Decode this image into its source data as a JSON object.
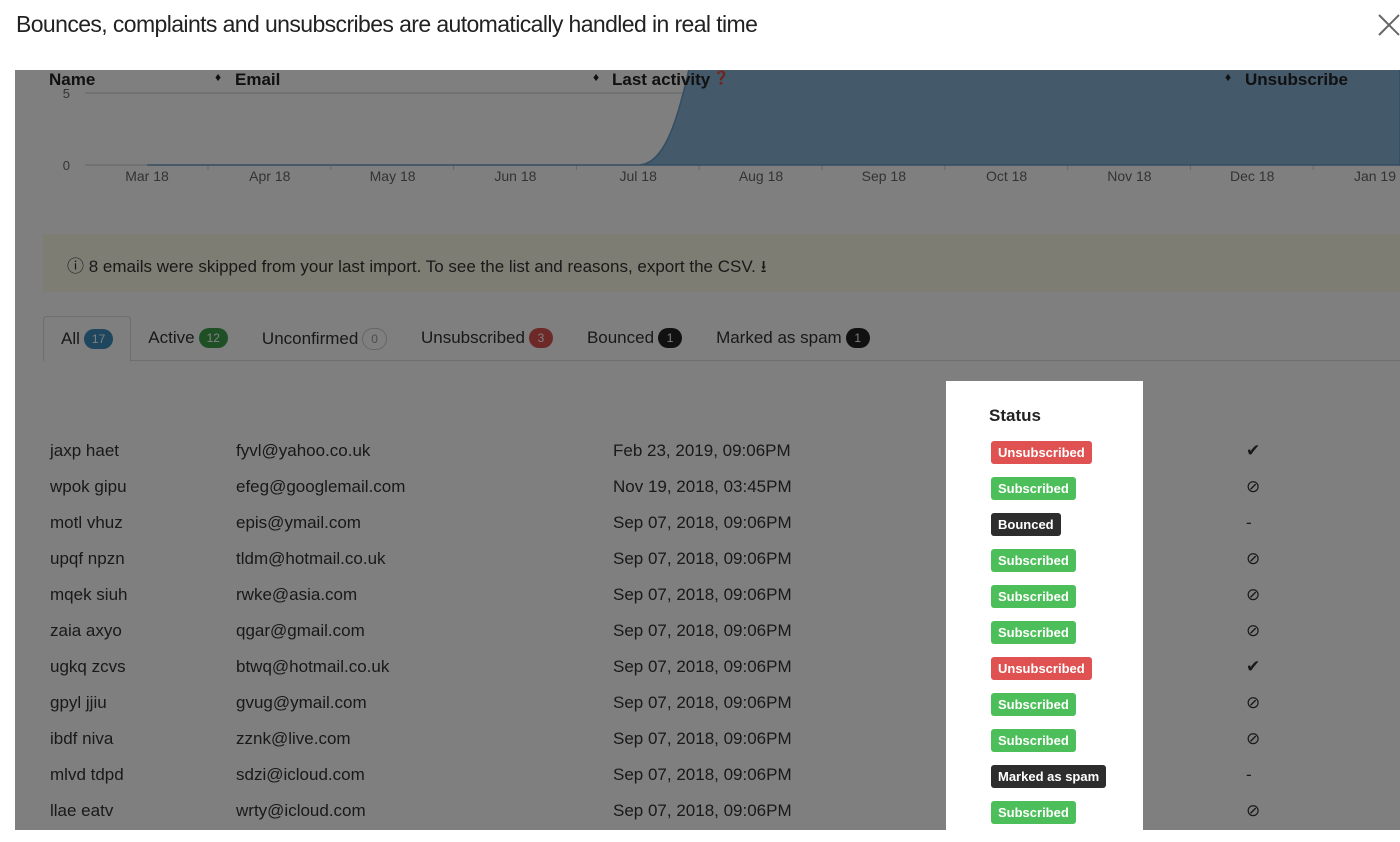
{
  "dialog": {
    "title": "Bounces, complaints and unsubscribes are automatically handled in real time",
    "close_icon": "close-icon"
  },
  "chart_data": {
    "type": "area",
    "x_ticks": [
      "Mar 18",
      "Apr 18",
      "May 18",
      "Jun 18",
      "Jul 18",
      "Aug 18",
      "Sep 18",
      "Oct 18",
      "Nov 18",
      "Dec 18",
      "Jan 19"
    ],
    "y_ticks": [
      "0",
      "5"
    ],
    "x": [
      "2018-03",
      "2018-04",
      "2018-05",
      "2018-06",
      "2018-07",
      "2018-08",
      "2018-09",
      "2018-10",
      "2018-11",
      "2018-12",
      "2019-01"
    ],
    "values": [
      0,
      0,
      0,
      0,
      0,
      17,
      17,
      17,
      17,
      17,
      17
    ],
    "color": "#88b2d4",
    "grid": true
  },
  "alert": {
    "text": "8 emails were skipped from your last import. To see the list and reasons, export the CSV.",
    "icon": "info-circle-icon",
    "download_icon": "download-icon"
  },
  "tabs": [
    {
      "label": "All",
      "count": "17",
      "color": "#3c8dbc",
      "active": true
    },
    {
      "label": "Active",
      "count": "12",
      "color": "#3fa14a"
    },
    {
      "label": "Unconfirmed",
      "count": "0",
      "color": "#ffffff"
    },
    {
      "label": "Unsubscribed",
      "count": "3",
      "color": "#d9534f"
    },
    {
      "label": "Bounced",
      "count": "1",
      "color": "#222222"
    },
    {
      "label": "Marked as spam",
      "count": "1",
      "color": "#222222"
    }
  ],
  "table": {
    "headers": {
      "name": "Name",
      "email": "Email",
      "last_activity": "Last activity",
      "status": "Status",
      "unsubscribe": "Unsubscribe"
    },
    "rows": [
      {
        "name": "jaxp haet",
        "email": "fyvl@yahoo.co.uk",
        "last": "Feb 23, 2019, 09:06PM",
        "status": "Unsubscribed",
        "unsub": "check"
      },
      {
        "name": "wpok gipu",
        "email": "efeg@googlemail.com",
        "last": "Nov 19, 2018, 03:45PM",
        "status": "Subscribed",
        "unsub": "ban"
      },
      {
        "name": "motl vhuz",
        "email": "epis@ymail.com",
        "last": "Sep 07, 2018, 09:06PM",
        "status": "Bounced",
        "unsub": "-"
      },
      {
        "name": "upqf npzn",
        "email": "tldm@hotmail.co.uk",
        "last": "Sep 07, 2018, 09:06PM",
        "status": "Subscribed",
        "unsub": "ban"
      },
      {
        "name": "mqek siuh",
        "email": "rwke@asia.com",
        "last": "Sep 07, 2018, 09:06PM",
        "status": "Subscribed",
        "unsub": "ban"
      },
      {
        "name": "zaia axyo",
        "email": "qgar@gmail.com",
        "last": "Sep 07, 2018, 09:06PM",
        "status": "Subscribed",
        "unsub": "ban"
      },
      {
        "name": "ugkq zcvs",
        "email": "btwq@hotmail.co.uk",
        "last": "Sep 07, 2018, 09:06PM",
        "status": "Unsubscribed",
        "unsub": "check"
      },
      {
        "name": "gpyl jjiu",
        "email": "gvug@ymail.com",
        "last": "Sep 07, 2018, 09:06PM",
        "status": "Subscribed",
        "unsub": "ban"
      },
      {
        "name": "ibdf niva",
        "email": "zznk@live.com",
        "last": "Sep 07, 2018, 09:06PM",
        "status": "Subscribed",
        "unsub": "ban"
      },
      {
        "name": "mlvd tdpd",
        "email": "sdzi@icloud.com",
        "last": "Sep 07, 2018, 09:06PM",
        "status": "Marked as spam",
        "unsub": "-"
      },
      {
        "name": "llae eatv",
        "email": "wrty@icloud.com",
        "last": "Sep 07, 2018, 09:06PM",
        "status": "Subscribed",
        "unsub": "ban"
      }
    ]
  },
  "status_colors": {
    "Unsubscribed": "#e05252",
    "Subscribed": "#4cbf5a",
    "Bounced": "#2d2d2d",
    "Marked as spam": "#2d2d2d"
  }
}
